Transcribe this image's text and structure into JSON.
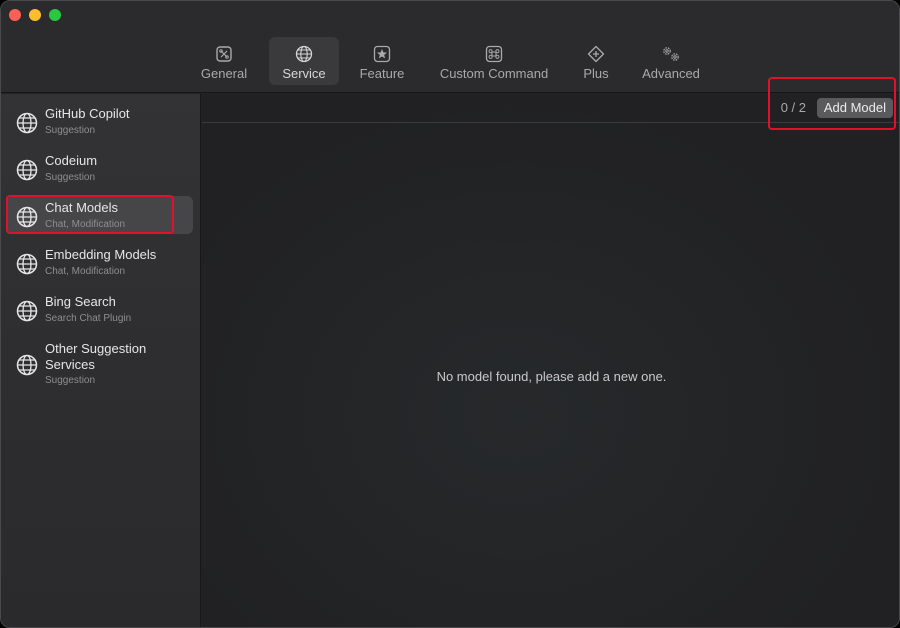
{
  "toolbar": {
    "tabs": [
      {
        "label": "General",
        "icon": "general-icon"
      },
      {
        "label": "Service",
        "icon": "globe-icon",
        "active": true
      },
      {
        "label": "Feature",
        "icon": "star-icon"
      },
      {
        "label": "Custom Command",
        "icon": "command-icon"
      },
      {
        "label": "Plus",
        "icon": "plus-diamond-icon"
      },
      {
        "label": "Advanced",
        "icon": "gears-icon"
      }
    ]
  },
  "sidebar": {
    "items": [
      {
        "title": "GitHub Copilot",
        "subtitle": "Suggestion"
      },
      {
        "title": "Codeium",
        "subtitle": "Suggestion"
      },
      {
        "title": "Chat Models",
        "subtitle": "Chat, Modification",
        "selected": true
      },
      {
        "title": "Embedding Models",
        "subtitle": "Chat, Modification"
      },
      {
        "title": "Bing Search",
        "subtitle": "Search Chat Plugin"
      },
      {
        "title": "Other Suggestion",
        "title2": "Services",
        "subtitle": "Suggestion"
      }
    ]
  },
  "main": {
    "count": "0 / 2",
    "add_button": "Add Model",
    "empty_message": "No model found, please add a new one."
  },
  "colors": {
    "highlight": "#e0102f",
    "window_bg": "#232325",
    "selected_bg": "#464648"
  }
}
